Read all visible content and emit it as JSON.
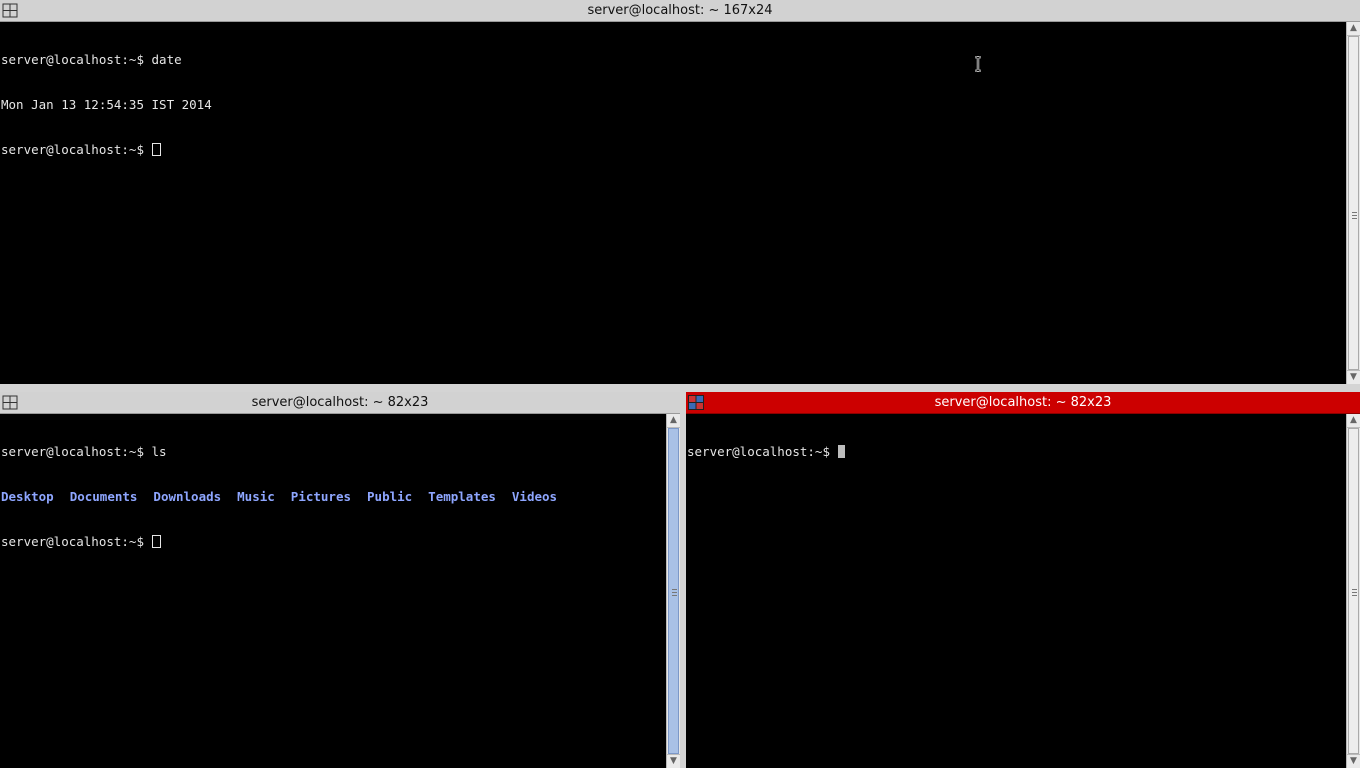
{
  "top_pane": {
    "title": "server@localhost: ~ 167x24",
    "lines": [
      "server@localhost:~$ date",
      "Mon Jan 13 12:54:35 IST 2014"
    ],
    "prompt": "server@localhost:~$ "
  },
  "bottom_left_pane": {
    "title": "server@localhost: ~ 82x23",
    "lines": [
      "server@localhost:~$ ls"
    ],
    "dirs": [
      "Desktop",
      "Documents",
      "Downloads",
      "Music",
      "Pictures",
      "Public",
      "Templates",
      "Videos"
    ],
    "prompt": "server@localhost:~$ "
  },
  "bottom_right_pane": {
    "title": "server@localhost: ~ 82x23",
    "prompt": "server@localhost:~$ ",
    "active": true,
    "titlebar_color": "#cc0000"
  },
  "colors": {
    "terminal_bg": "#000000",
    "terminal_fg": "#e6e6e6",
    "directory": "#8ea6ff",
    "scroll_thumb_active": "#a9c1e6"
  },
  "icons": {
    "window_menu": "window-menu-icon",
    "mouse": "ibeam-cursor-icon"
  }
}
